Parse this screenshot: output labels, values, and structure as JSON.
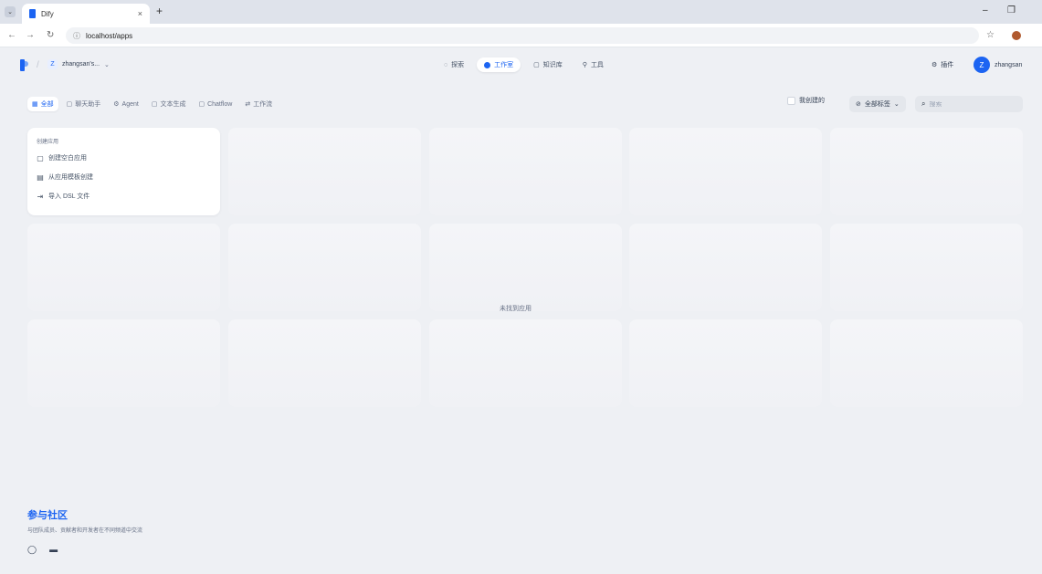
{
  "browser": {
    "tab_title": "Dify",
    "tab_close": "×",
    "new_tab": "+",
    "menu_chevron": "⌄",
    "window_minimize": "–",
    "window_restore": "❐",
    "url": "localhost/apps",
    "url_info_glyph": "ⓘ",
    "back_glyph": "←",
    "forward_glyph": "→",
    "reload_glyph": "↻",
    "bookmark_glyph": "☆"
  },
  "header": {
    "separator": "/",
    "workspace_initial": "Z",
    "workspace_name": "zhangsan's...",
    "workspace_caret": "⌄",
    "nav": [
      {
        "icon": "compass-icon",
        "glyph": "◌",
        "label": "探索"
      },
      {
        "icon": "studio-icon",
        "glyph": "",
        "label": "工作室"
      },
      {
        "icon": "knowledge-icon",
        "glyph": "▢",
        "label": "知识库"
      },
      {
        "icon": "tools-icon",
        "glyph": "⚲",
        "label": "工具"
      }
    ],
    "plugin_glyph": "⚙",
    "plugin_label": "插件",
    "user_initial": "Z",
    "user_name": "zhangsan"
  },
  "filters": {
    "tabs": [
      {
        "icon": "grid-icon",
        "glyph": "▦",
        "label": "全部"
      },
      {
        "icon": "chat-icon",
        "glyph": "▢",
        "label": "聊天助手"
      },
      {
        "icon": "agent-icon",
        "glyph": "⚙",
        "label": "Agent"
      },
      {
        "icon": "text-icon",
        "glyph": "▢",
        "label": "文本生成"
      },
      {
        "icon": "chatflow-icon",
        "glyph": "▢",
        "label": "Chatflow"
      },
      {
        "icon": "workflow-icon",
        "glyph": "⇄",
        "label": "工作流"
      }
    ],
    "mine_label": "我创建的",
    "tag_glyph": "⊘",
    "tag_label": "全部标签",
    "tag_caret": "⌄",
    "search_glyph": "⌕",
    "search_placeholder": "搜索"
  },
  "create_card": {
    "title": "创建应用",
    "items": [
      {
        "icon": "blank-file-icon",
        "glyph": "▢",
        "label": "创建空白应用"
      },
      {
        "icon": "template-icon",
        "glyph": "▤",
        "label": "从应用模板创建"
      },
      {
        "icon": "import-icon",
        "glyph": "⇥",
        "label": "导入 DSL 文件"
      }
    ]
  },
  "empty_message": "未找到应用",
  "community": {
    "title": "参与社区",
    "description": "与团队成员、贡献者和开发者在不同频道中交流",
    "github_glyph": "◯",
    "discord_glyph": "▬"
  }
}
